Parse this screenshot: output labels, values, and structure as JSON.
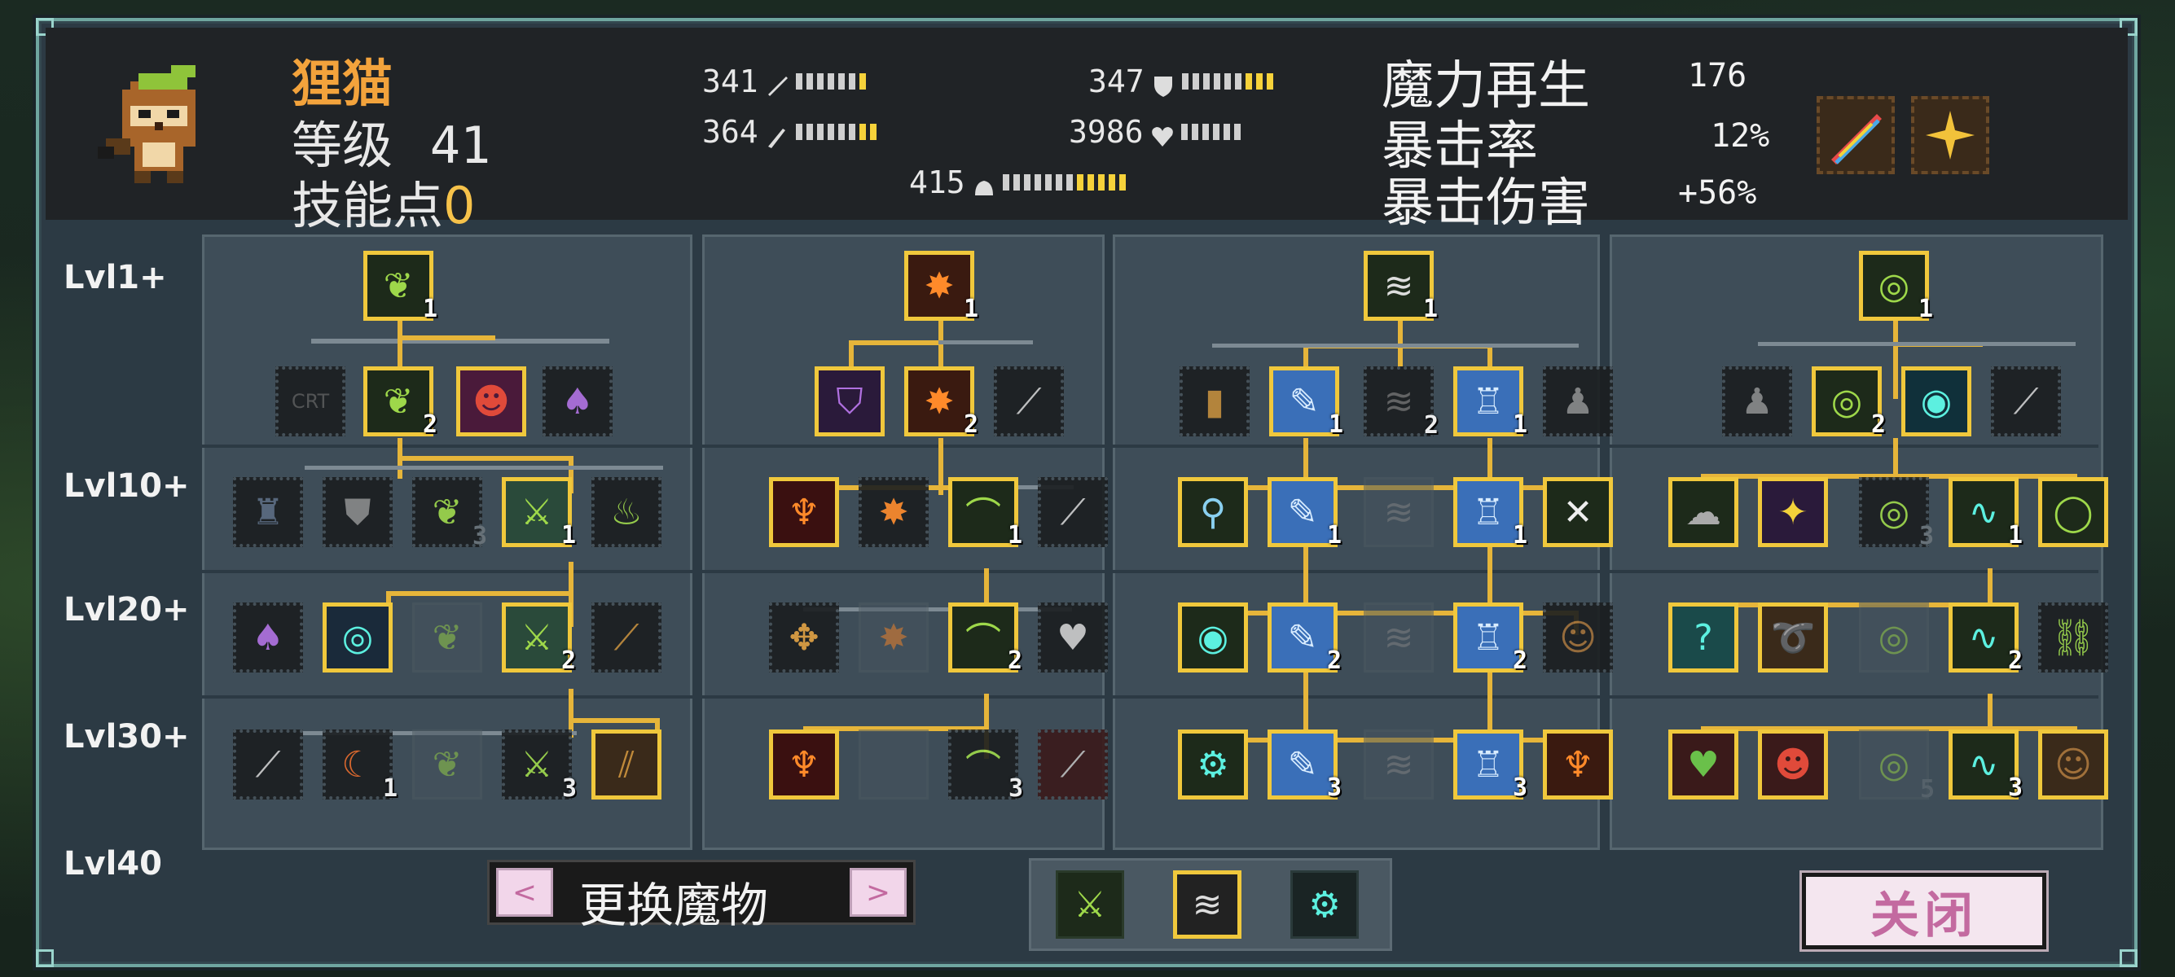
{
  "character": {
    "name": "狸猫",
    "level_label": "等级",
    "level": "41",
    "skill_points_label": "技能点",
    "skill_points": "0"
  },
  "stats": {
    "attack": "341",
    "magic_attack": "364",
    "defense": "347",
    "health": "3986",
    "speed": "415",
    "mana_regen_label": "魔力再生",
    "mana_regen": "176",
    "crit_rate_label": "暴击率",
    "crit_rate": "12%",
    "crit_damage_label": "暴击伤害",
    "crit_damage": "+56%"
  },
  "tiers": [
    "Lvl1+",
    "Lvl10+",
    "Lvl20+",
    "Lvl30+",
    "Lvl40"
  ],
  "skills": [
    {
      "lv": "1"
    },
    {
      "lv": ""
    },
    {
      "lv": "2"
    },
    {
      "lv": ""
    },
    {
      "lv": ""
    },
    {
      "lv": ""
    },
    {
      "lv": ""
    },
    {
      "lv": "3"
    },
    {
      "lv": "1"
    },
    {
      "lv": ""
    },
    {
      "lv": ""
    },
    {
      "lv": ""
    },
    {
      "lv": ""
    },
    {
      "lv": "2"
    },
    {
      "lv": ""
    },
    {
      "lv": ""
    },
    {
      "lv": "1"
    },
    {
      "lv": ""
    },
    {
      "lv": "3"
    },
    {
      "lv": ""
    },
    {
      "lv": "1"
    },
    {
      "lv": ""
    },
    {
      "lv": "2"
    },
    {
      "lv": ""
    },
    {
      "lv": ""
    },
    {
      "lv": ""
    },
    {
      "lv": "3"
    },
    {
      "lv": "1"
    },
    {
      "lv": ""
    },
    {
      "lv": ""
    },
    {
      "lv": ""
    },
    {
      "lv": "2"
    },
    {
      "lv": ""
    },
    {
      "lv": ""
    },
    {
      "lv": ""
    },
    {
      "lv": "3"
    },
    {
      "lv": ""
    },
    {
      "lv": "1"
    },
    {
      "lv": ""
    },
    {
      "lv": "1"
    },
    {
      "lv": "2"
    },
    {
      "lv": "1"
    },
    {
      "lv": ""
    },
    {
      "lv": ""
    },
    {
      "lv": "1"
    },
    {
      "lv": ""
    },
    {
      "lv": "1"
    },
    {
      "lv": ""
    },
    {
      "lv": ""
    },
    {
      "lv": "2"
    },
    {
      "lv": ""
    },
    {
      "lv": "2"
    },
    {
      "lv": ""
    },
    {
      "lv": ""
    },
    {
      "lv": "3"
    },
    {
      "lv": ""
    },
    {
      "lv": "3"
    },
    {
      "lv": ""
    },
    {
      "lv": "1"
    },
    {
      "lv": ""
    },
    {
      "lv": "2"
    },
    {
      "lv": ""
    },
    {
      "lv": ""
    },
    {
      "lv": ""
    },
    {
      "lv": ""
    },
    {
      "lv": "3"
    },
    {
      "lv": "1"
    },
    {
      "lv": ""
    },
    {
      "lv": ""
    },
    {
      "lv": ""
    },
    {
      "lv": ""
    },
    {
      "lv": "2"
    },
    {
      "lv": ""
    },
    {
      "lv": ""
    },
    {
      "lv": ""
    },
    {
      "lv": "5"
    },
    {
      "lv": "3"
    },
    {
      "lv": ""
    }
  ],
  "swap_monster_label": "更换魔物",
  "prev_arrow": "<",
  "next_arrow": ">",
  "close_label": "关闭",
  "colors": {
    "gold_line": "#e6b53a",
    "name_orange": "#f3a33c",
    "close_pink": "#c36aa0"
  }
}
